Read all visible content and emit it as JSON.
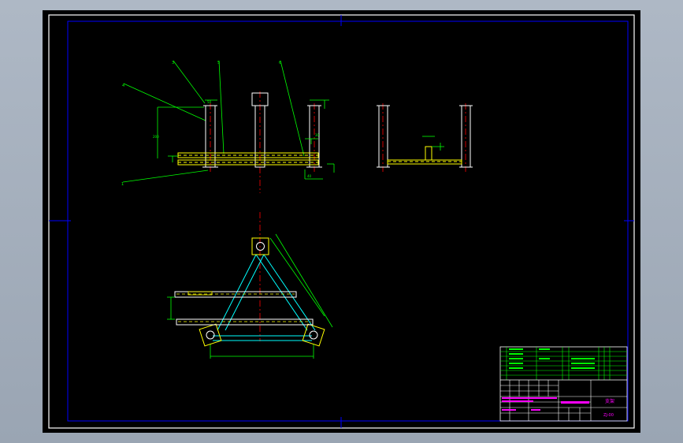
{
  "colors": {
    "viewport_bg": "#a7b1bf",
    "canvas_bg": "#000000",
    "frame": "#ffffff",
    "border": "#0000ff",
    "dimension": "#00ff00",
    "outline": "#ffffff",
    "centerline": "#ff0000",
    "channel": "#ffff00",
    "brace": "#00ffff",
    "title_text": "#ff00ff",
    "grid": "#00ff00"
  },
  "drawing": {
    "title_block": {
      "drawing_name": "支架",
      "drawing_number": "ZJ-00"
    }
  }
}
